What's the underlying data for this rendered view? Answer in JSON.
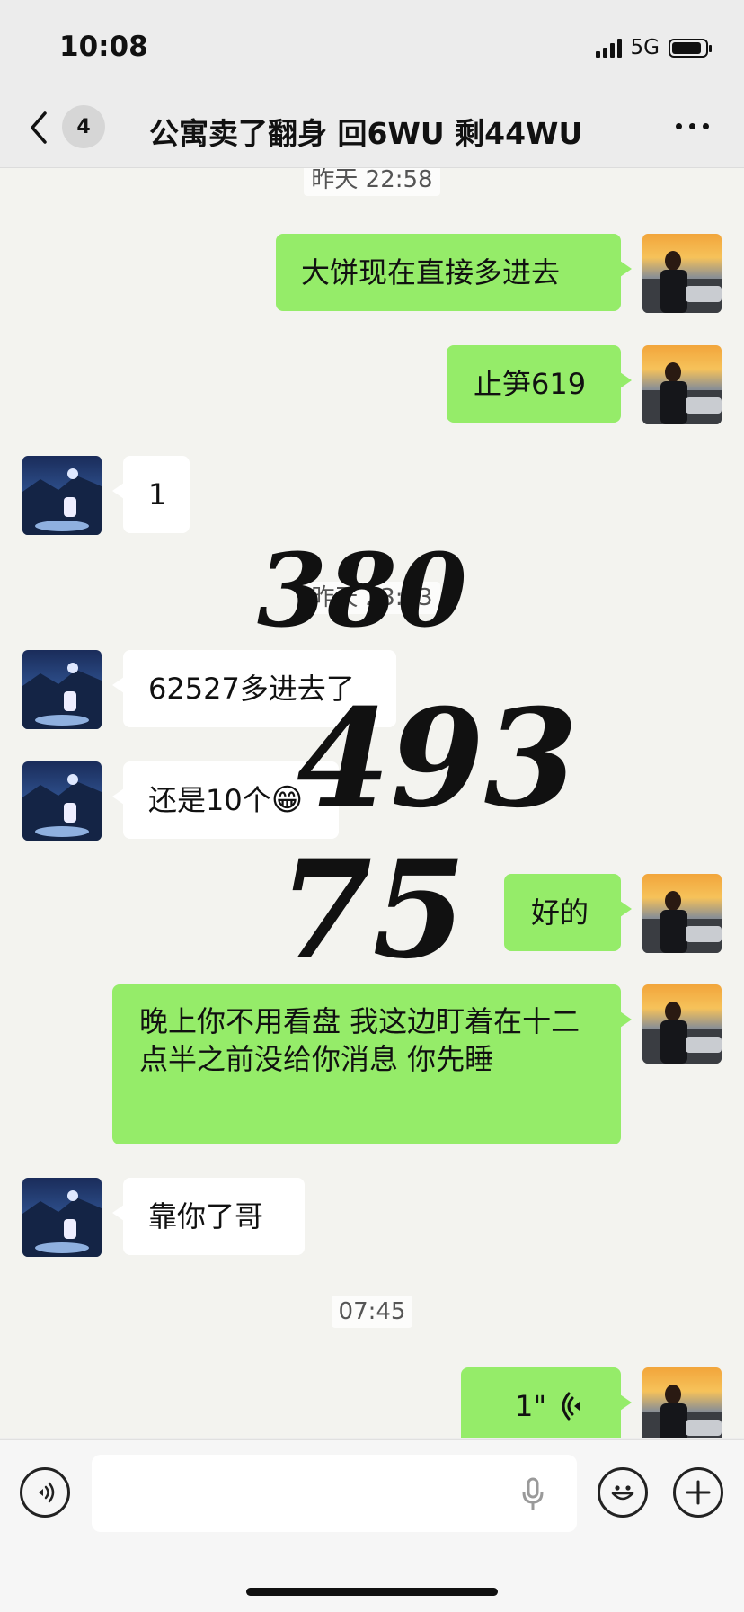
{
  "status_bar": {
    "time": "10:08",
    "network": "5G"
  },
  "nav": {
    "unread_count": "4",
    "title": "公寓卖了翻身 回6WU 剩44WU"
  },
  "timestamps": [
    "昨天 22:58",
    "昨天 23:03",
    "07:45"
  ],
  "messages": [
    {
      "sender": "me",
      "text": "大饼现在直接多进去"
    },
    {
      "sender": "me",
      "text": "止笋619"
    },
    {
      "sender": "other",
      "text": "1"
    },
    {
      "sender": "other",
      "text": "62527多进去了"
    },
    {
      "sender": "other",
      "text": "还是10个",
      "emoji": "😁"
    },
    {
      "sender": "me",
      "text": "好的"
    },
    {
      "sender": "me",
      "text": "晚上你不用看盘 我这边盯着在十二点半之前没给你消息 你先睡"
    },
    {
      "sender": "other",
      "text": "靠你了哥"
    },
    {
      "sender": "me",
      "voice_duration": "1\""
    }
  ],
  "overlay_numbers": [
    "380",
    "493",
    "75"
  ],
  "icons": {
    "back": "chevron-left-icon",
    "more": "more-dots-icon",
    "voice_toggle": "voice-mode-icon",
    "mic": "microphone-icon",
    "emoji": "emoji-face-icon",
    "plus": "plus-icon"
  },
  "colors": {
    "my_bubble": "#95ec69",
    "their_bubble": "#ffffff",
    "background": "#f3f3ef"
  }
}
